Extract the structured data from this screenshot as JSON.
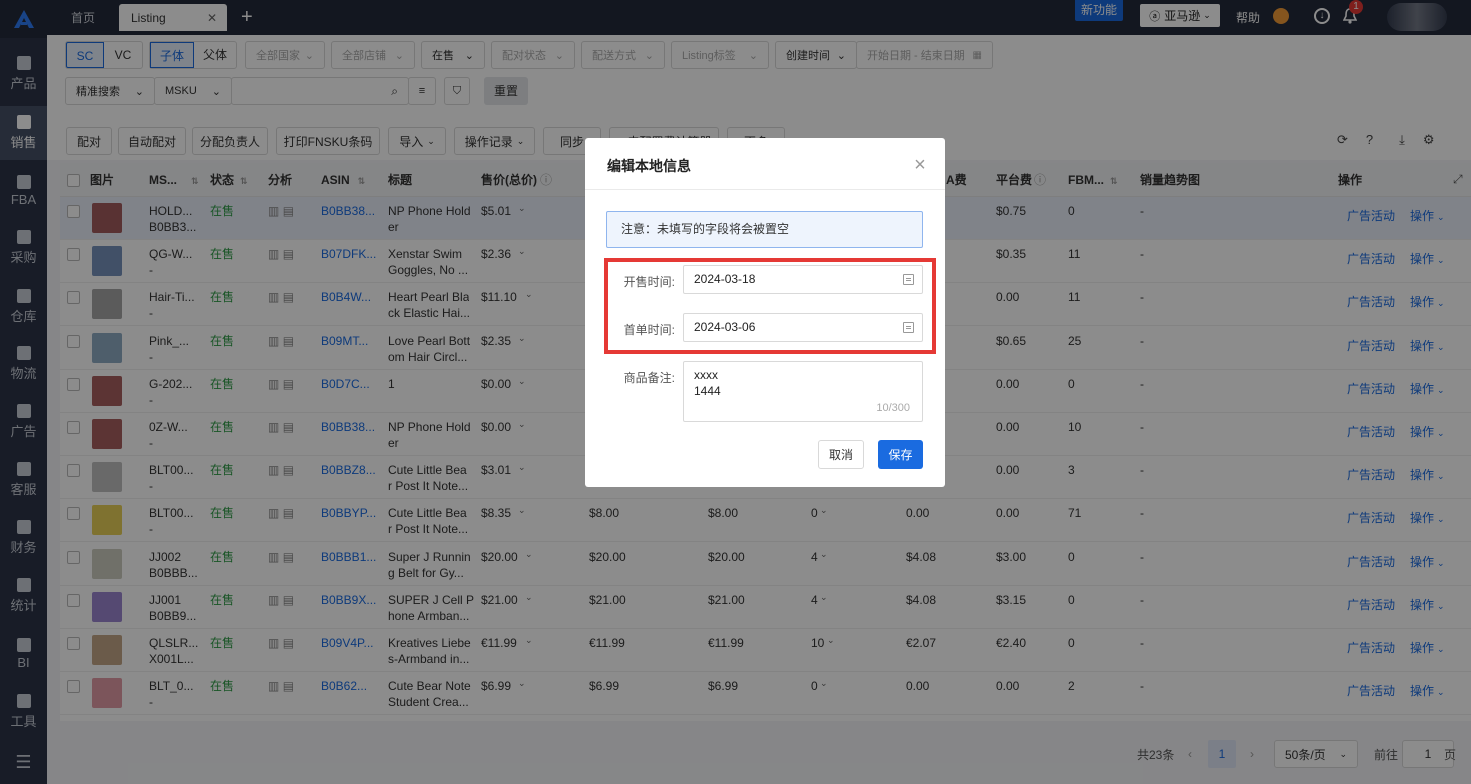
{
  "sidebar": {
    "items": [
      {
        "label": "产品",
        "icon": "box-icon"
      },
      {
        "label": "销售",
        "icon": "sell-icon"
      },
      {
        "label": "FBA",
        "icon": "fba-icon"
      },
      {
        "label": "采购",
        "icon": "cart-icon"
      },
      {
        "label": "仓库",
        "icon": "warehouse-icon"
      },
      {
        "label": "物流",
        "icon": "truck-icon"
      },
      {
        "label": "广告",
        "icon": "ad-icon"
      },
      {
        "label": "客服",
        "icon": "mail-icon"
      },
      {
        "label": "财务",
        "icon": "yen-icon"
      },
      {
        "label": "统计",
        "icon": "pie-icon"
      },
      {
        "label": "BI",
        "icon": "bi-icon"
      },
      {
        "label": "工具",
        "icon": "wrench-icon"
      }
    ]
  },
  "topbar": {
    "tabs": [
      "首页",
      "Listing"
    ],
    "new_feature": "新功能",
    "marketplace": "亚马逊",
    "help": "帮助",
    "notif_count": "1"
  },
  "filters": {
    "sc": "SC",
    "vc": "VC",
    "child": "子体",
    "parent": "父体",
    "all_countries": "全部国家",
    "all_shops": "全部店铺",
    "status": "在售",
    "pair_status": "配对状态",
    "ship_method": "配送方式",
    "listing_tag": "Listing标签",
    "created_time": "创建时间",
    "date_range": "开始日期 - 结束日期",
    "search_mode": "精准搜索",
    "search_field": "MSKU",
    "reset": "重置"
  },
  "actions": [
    "配对",
    "自动配对",
    "分配负责人",
    "打印FNSKU条码",
    "导入",
    "操作记录",
    "同步",
    "ㅅ申配置费计算器",
    "更多"
  ],
  "table": {
    "headers": {
      "image": "图片",
      "msku": "MS...",
      "status": "状态",
      "analysis": "分析",
      "asin": "ASIN",
      "title": "标题",
      "price": "售价(总价)",
      "fba_fee": "A费",
      "platform_fee": "平台费",
      "fbm": "FBM...",
      "trend": "销量趋势图",
      "ops": "操作"
    },
    "rows": [
      {
        "msku1": "HOLD...",
        "msku2": "B0BB3...",
        "status": "在售",
        "asin": "B0BB38...",
        "title1": "NP Phone Hold",
        "title2": "er",
        "price": "$5.01",
        "p2": "",
        "p3": "",
        "qty": "",
        "fba": "",
        "pf": "$0.75",
        "fbm": "0",
        "trend": "-"
      },
      {
        "msku1": "QG-W...",
        "msku2": "-",
        "status": "在售",
        "asin": "B07DFK...",
        "title1": "Xenstar Swim",
        "title2": "Goggles, No ...",
        "price": "$2.36",
        "p2": "",
        "p3": "",
        "qty": "",
        "fba": "",
        "pf": "$0.35",
        "fbm": "11",
        "trend": "-"
      },
      {
        "msku1": "Hair-Ti...",
        "msku2": "-",
        "status": "在售",
        "asin": "B0B4W...",
        "title1": "Heart Pearl Bla",
        "title2": "ck Elastic Hai...",
        "price": "$11.10",
        "p2": "",
        "p3": "",
        "qty": "",
        "fba": "",
        "pf": "0.00",
        "fbm": "11",
        "trend": "-"
      },
      {
        "msku1": "Pink_...",
        "msku2": "-",
        "status": "在售",
        "asin": "B09MT...",
        "title1": "Love Pearl Bott",
        "title2": "om Hair Circl...",
        "price": "$2.35",
        "p2": "",
        "p3": "",
        "qty": "",
        "fba": "",
        "pf": "$0.65",
        "fbm": "25",
        "trend": "-"
      },
      {
        "msku1": "G-202...",
        "msku2": "-",
        "status": "在售",
        "asin": "B0D7C...",
        "title1": "1",
        "title2": "",
        "price": "$0.00",
        "p2": "",
        "p3": "",
        "qty": "",
        "fba": "",
        "pf": "0.00",
        "fbm": "0",
        "trend": "-"
      },
      {
        "msku1": "0Z-W...",
        "msku2": "-",
        "status": "在售",
        "asin": "B0BB38...",
        "title1": "NP Phone Hold",
        "title2": "er",
        "price": "$0.00",
        "p2": "",
        "p3": "",
        "qty": "",
        "fba": "",
        "pf": "0.00",
        "fbm": "10",
        "trend": "-"
      },
      {
        "msku1": "BLT00...",
        "msku2": "-",
        "status": "在售",
        "asin": "B0BBZ8...",
        "title1": "Cute Little Bea",
        "title2": "r Post It Note...",
        "price": "$3.01",
        "p2": "",
        "p3": "",
        "qty": "",
        "fba": "",
        "pf": "0.00",
        "fbm": "3",
        "trend": "-"
      },
      {
        "msku1": "BLT00...",
        "msku2": "-",
        "status": "在售",
        "asin": "B0BBYP...",
        "title1": "Cute Little Bea",
        "title2": "r Post It Note...",
        "price": "$8.35",
        "p2": "$8.00",
        "p3": "$8.00",
        "qty": "0",
        "fba": "0.00",
        "pf": "0.00",
        "fbm": "71",
        "trend": "-"
      },
      {
        "msku1": "JJ002",
        "msku2": "B0BBB...",
        "status": "在售",
        "asin": "B0BBB1...",
        "title1": "Super J Runnin",
        "title2": "g Belt for Gy...",
        "price": "$20.00",
        "p2": "$20.00",
        "p3": "$20.00",
        "qty": "4",
        "fba": "$4.08",
        "pf": "$3.00",
        "fbm": "0",
        "trend": "-"
      },
      {
        "msku1": "JJ001",
        "msku2": "B0BB9...",
        "status": "在售",
        "asin": "B0BB9X...",
        "title1": "SUPER J Cell P",
        "title2": "hone Armban...",
        "price": "$21.00",
        "p2": "$21.00",
        "p3": "$21.00",
        "qty": "4",
        "fba": "$4.08",
        "pf": "$3.15",
        "fbm": "0",
        "trend": "-"
      },
      {
        "msku1": "QLSLR...",
        "msku2": "X001L...",
        "status": "在售",
        "asin": "B09V4P...",
        "title1": "Kreatives Liebe",
        "title2": "s-Armband in...",
        "price": "€11.99",
        "p2": "€11.99",
        "p3": "€11.99",
        "qty": "10",
        "fba": "€2.07",
        "pf": "€2.40",
        "fbm": "0",
        "trend": "-"
      },
      {
        "msku1": "BLT_0...",
        "msku2": "-",
        "status": "在售",
        "asin": "B0B62...",
        "title1": "Cute Bear Note",
        "title2": "Student Crea...",
        "price": "$6.99",
        "p2": "$6.99",
        "p3": "$6.99",
        "qty": "0",
        "fba": "0.00",
        "pf": "0.00",
        "fbm": "2",
        "trend": "-"
      }
    ],
    "op_ad": "广告活动",
    "op_more": "操作"
  },
  "pager": {
    "total": "共23条",
    "page": "1",
    "per_page": "50条/页",
    "goto": "前往",
    "goto_value": "1",
    "page_suffix": "页"
  },
  "modal": {
    "title": "编辑本地信息",
    "notice": "注意：未填写的字段将会被置空",
    "open_label": "开售时间:",
    "open_value": "2024-03-18",
    "first_label": "首单时间:",
    "first_value": "2024-03-06",
    "remark_label": "商品备注:",
    "remark_value": "xxxx\n1444",
    "remark_count": "10/300",
    "cancel": "取消",
    "save": "保存"
  },
  "colors": {
    "accent": "#1a6be0",
    "sidebar": "#2d3447",
    "highlight": "#e53935",
    "status_green": "#2e9b46"
  }
}
